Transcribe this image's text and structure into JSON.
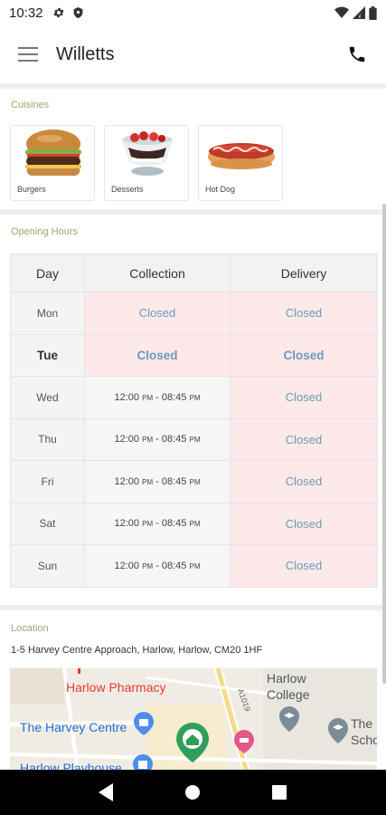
{
  "status_bar": {
    "time": "10:32",
    "icons": [
      "gear-icon",
      "shield-icon",
      "wifi-icon",
      "signal-icon",
      "battery-icon"
    ]
  },
  "app_bar": {
    "title": "Willetts",
    "menu_icon": "hamburger-menu-icon",
    "action_icon": "phone-icon"
  },
  "cuisines": {
    "label": "Cuisines",
    "items": [
      {
        "label": "Burgers",
        "icon": "burger-image"
      },
      {
        "label": "Desserts",
        "icon": "dessert-image"
      },
      {
        "label": "Hot Dog",
        "icon": "hot-dog-image"
      }
    ]
  },
  "opening_hours": {
    "label": "Opening Hours",
    "headers": {
      "day": "Day",
      "collection": "Collection",
      "delivery": "Delivery"
    },
    "rows": [
      {
        "day": "Mon",
        "collection": "Closed",
        "delivery": "Closed"
      },
      {
        "day": "Tue",
        "collection": "Closed",
        "delivery": "Closed"
      },
      {
        "day": "Wed",
        "collection_open": "12:00",
        "collection_open_suffix": "PM",
        "collection_sep": " - ",
        "collection_close": "08:45",
        "collection_close_suffix": "PM",
        "delivery": "Closed"
      },
      {
        "day": "Thu",
        "collection_open": "12:00",
        "collection_open_suffix": "PM",
        "collection_sep": " - ",
        "collection_close": "08:45",
        "collection_close_suffix": "PM",
        "delivery": "Closed"
      },
      {
        "day": "Fri",
        "collection_open": "12:00",
        "collection_open_suffix": "PM",
        "collection_sep": " - ",
        "collection_close": "08:45",
        "collection_close_suffix": "PM",
        "delivery": "Closed"
      },
      {
        "day": "Sat",
        "collection_open": "12:00",
        "collection_open_suffix": "PM",
        "collection_sep": " - ",
        "collection_close": "08:45",
        "collection_close_suffix": "PM",
        "delivery": "Closed"
      },
      {
        "day": "Sun",
        "collection_open": "12:00",
        "collection_open_suffix": "PM",
        "collection_sep": " - ",
        "collection_close": "08:45",
        "collection_close_suffix": "PM",
        "delivery": "Closed"
      }
    ],
    "today": "Tue"
  },
  "location": {
    "label": "Location",
    "address": "1-5 Harvey Centre Approach, Harlow, Harlow, CM20 1HF",
    "map_labels": {
      "pharmacy": "Harlow Pharmacy",
      "harvey_centre": "The Harvey Centre",
      "college_1": "Harlow",
      "college_2": "College",
      "road": "A1019",
      "school_1": "The",
      "school_2": "Scho",
      "playhouse": "Harlow Playhouse"
    }
  },
  "colors": {
    "section_label": "#a8a070",
    "closed_text": "#6a9bb6",
    "closed_bg": "#fde9ea"
  },
  "nav_bar": {
    "icons": [
      "back-icon",
      "home-icon",
      "recents-icon"
    ]
  }
}
